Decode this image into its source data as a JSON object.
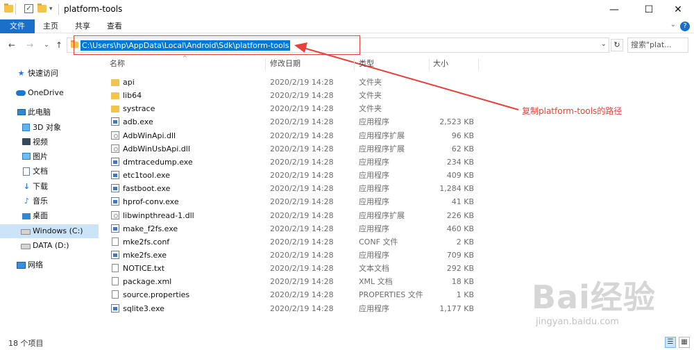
{
  "window": {
    "title": "platform-tools",
    "controls": [
      "—",
      "☐",
      "✕"
    ]
  },
  "ribbon": {
    "tabs": [
      "文件",
      "主页",
      "共享",
      "查看"
    ],
    "help_glyph": "?"
  },
  "navigation": {
    "address_path": "C:\\Users\\hp\\AppData\\Local\\Android\\Sdk\\platform-tools",
    "search_placeholder": "搜索\"plat..."
  },
  "annotation": {
    "note": "复制platform-tools的路径",
    "color": "#e8413b"
  },
  "sidebar": {
    "items": [
      {
        "label": "快速访问",
        "icon": "star-icon"
      },
      {
        "label": "OneDrive",
        "icon": "cloud-icon"
      },
      {
        "label": "此电脑",
        "icon": "computer-icon"
      },
      {
        "label": "3D 对象",
        "icon": "cube-icon"
      },
      {
        "label": "视频",
        "icon": "video-icon"
      },
      {
        "label": "图片",
        "icon": "picture-icon"
      },
      {
        "label": "文档",
        "icon": "document-icon"
      },
      {
        "label": "下载",
        "icon": "download-icon"
      },
      {
        "label": "音乐",
        "icon": "music-icon"
      },
      {
        "label": "桌面",
        "icon": "desktop-icon"
      },
      {
        "label": "Windows (C:)",
        "icon": "drive-icon",
        "selected": true
      },
      {
        "label": "DATA (D:)",
        "icon": "drive-icon"
      },
      {
        "label": "网络",
        "icon": "network-icon"
      }
    ]
  },
  "file_list": {
    "columns": {
      "name": "名称",
      "date": "修改日期",
      "type": "类型",
      "size": "大小"
    },
    "rows": [
      {
        "name": "api",
        "date": "2020/2/19 14:28",
        "type": "文件夹",
        "size": "",
        "icon": "folder"
      },
      {
        "name": "lib64",
        "date": "2020/2/19 14:28",
        "type": "文件夹",
        "size": "",
        "icon": "folder"
      },
      {
        "name": "systrace",
        "date": "2020/2/19 14:28",
        "type": "文件夹",
        "size": "",
        "icon": "folder"
      },
      {
        "name": "adb.exe",
        "date": "2020/2/19 14:28",
        "type": "应用程序",
        "size": "2,523 KB",
        "icon": "exe"
      },
      {
        "name": "AdbWinApi.dll",
        "date": "2020/2/19 14:28",
        "type": "应用程序扩展",
        "size": "96 KB",
        "icon": "dll"
      },
      {
        "name": "AdbWinUsbApi.dll",
        "date": "2020/2/19 14:28",
        "type": "应用程序扩展",
        "size": "62 KB",
        "icon": "dll"
      },
      {
        "name": "dmtracedump.exe",
        "date": "2020/2/19 14:28",
        "type": "应用程序",
        "size": "234 KB",
        "icon": "exe"
      },
      {
        "name": "etc1tool.exe",
        "date": "2020/2/19 14:28",
        "type": "应用程序",
        "size": "409 KB",
        "icon": "exe"
      },
      {
        "name": "fastboot.exe",
        "date": "2020/2/19 14:28",
        "type": "应用程序",
        "size": "1,284 KB",
        "icon": "exe"
      },
      {
        "name": "hprof-conv.exe",
        "date": "2020/2/19 14:28",
        "type": "应用程序",
        "size": "41 KB",
        "icon": "exe"
      },
      {
        "name": "libwinpthread-1.dll",
        "date": "2020/2/19 14:28",
        "type": "应用程序扩展",
        "size": "226 KB",
        "icon": "dll"
      },
      {
        "name": "make_f2fs.exe",
        "date": "2020/2/19 14:28",
        "type": "应用程序",
        "size": "460 KB",
        "icon": "exe"
      },
      {
        "name": "mke2fs.conf",
        "date": "2020/2/19 14:28",
        "type": "CONF 文件",
        "size": "2 KB",
        "icon": "doc"
      },
      {
        "name": "mke2fs.exe",
        "date": "2020/2/19 14:28",
        "type": "应用程序",
        "size": "709 KB",
        "icon": "exe"
      },
      {
        "name": "NOTICE.txt",
        "date": "2020/2/19 14:28",
        "type": "文本文档",
        "size": "292 KB",
        "icon": "doc"
      },
      {
        "name": "package.xml",
        "date": "2020/2/19 14:28",
        "type": "XML 文档",
        "size": "18 KB",
        "icon": "doc"
      },
      {
        "name": "source.properties",
        "date": "2020/2/19 14:28",
        "type": "PROPERTIES 文件",
        "size": "1 KB",
        "icon": "doc"
      },
      {
        "name": "sqlite3.exe",
        "date": "2020/2/19 14:28",
        "type": "应用程序",
        "size": "1,177 KB",
        "icon": "exe"
      }
    ]
  },
  "status": {
    "item_count": "18 个项目"
  },
  "watermark": {
    "brand": "Bai经验",
    "url": "jingyan.baidu.com"
  }
}
